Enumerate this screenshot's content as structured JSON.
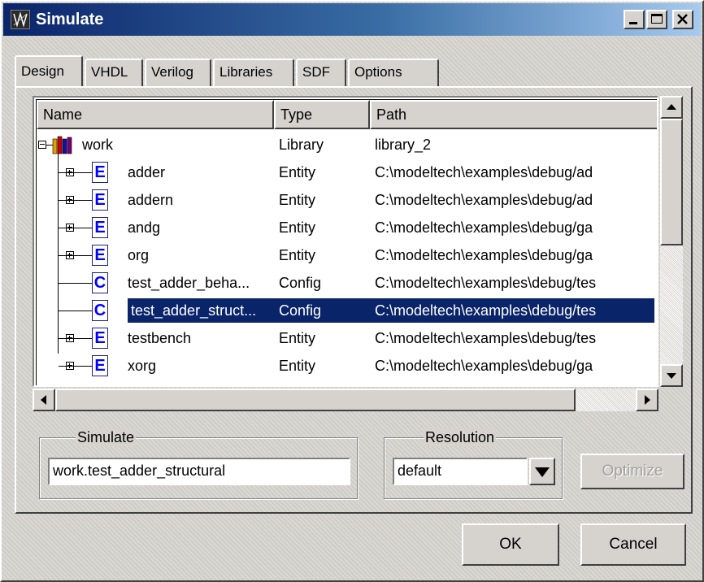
{
  "window": {
    "title": "Simulate",
    "icon": "modelsim-app-icon",
    "controls": [
      "minimize-icon",
      "maximize-icon",
      "close-icon"
    ]
  },
  "tabs": [
    "Design",
    "VHDL",
    "Verilog",
    "Libraries",
    "SDF",
    "Options"
  ],
  "active_tab": "Design",
  "columns": [
    "Name",
    "Type",
    "Path"
  ],
  "rows": [
    {
      "name": "work",
      "type": "Library",
      "path": "library_2",
      "icon": "library-icon",
      "expander": "collapse"
    },
    {
      "name": "adder",
      "type": "Entity",
      "path": "C:\\modeltech\\examples\\debug/ad",
      "icon": "entity-icon",
      "icon_letter": "E",
      "expander": "expand"
    },
    {
      "name": "addern",
      "type": "Entity",
      "path": "C:\\modeltech\\examples\\debug/ad",
      "icon": "entity-icon",
      "icon_letter": "E",
      "expander": "expand"
    },
    {
      "name": "andg",
      "type": "Entity",
      "path": "C:\\modeltech\\examples\\debug/ga",
      "icon": "entity-icon",
      "icon_letter": "E",
      "expander": "expand"
    },
    {
      "name": "org",
      "type": "Entity",
      "path": "C:\\modeltech\\examples\\debug/ga",
      "icon": "entity-icon",
      "icon_letter": "E",
      "expander": "expand"
    },
    {
      "name": "test_adder_beha...",
      "type": "Config",
      "path": "C:\\modeltech\\examples\\debug/tes",
      "icon": "config-icon",
      "icon_letter": "C",
      "expander": "none"
    },
    {
      "name": "test_adder_struct...",
      "type": "Config",
      "path": "C:\\modeltech\\examples\\debug/tes",
      "icon": "config-icon",
      "icon_letter": "C",
      "expander": "none",
      "selected": true
    },
    {
      "name": "testbench",
      "type": "Entity",
      "path": "C:\\modeltech\\examples\\debug/tes",
      "icon": "entity-icon",
      "icon_letter": "E",
      "expander": "expand"
    },
    {
      "name": "xorg",
      "type": "Entity",
      "path": "C:\\modeltech\\examples\\debug/ga",
      "icon": "entity-icon",
      "icon_letter": "E",
      "expander": "expand"
    }
  ],
  "simulate": {
    "group_label": "Simulate",
    "value": "work.test_adder_structural"
  },
  "resolution": {
    "group_label": "Resolution",
    "selected": "default"
  },
  "buttons": {
    "optimize": "Optimize",
    "ok": "OK",
    "cancel": "Cancel"
  },
  "colors": {
    "title_gradient_start": "#0a246a",
    "title_gradient_end": "#a6caf0",
    "selection": "#0a246a",
    "face": "#d6d3ce"
  }
}
